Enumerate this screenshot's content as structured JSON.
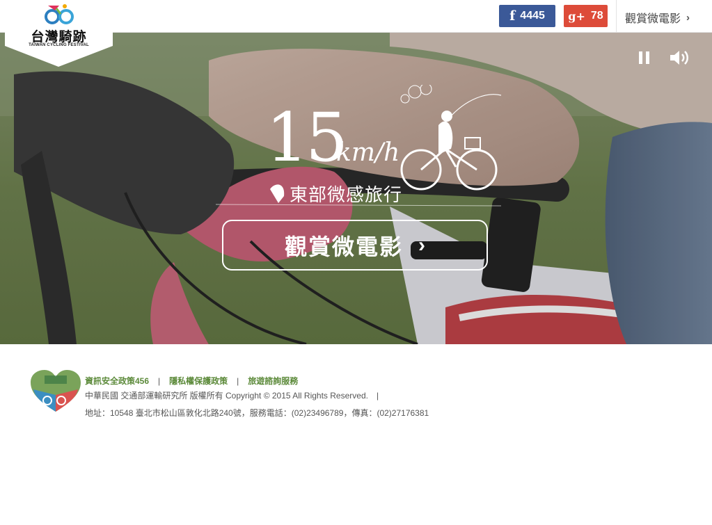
{
  "header": {
    "logo_text": "台灣騎跡",
    "logo_subtext": "TAIWAN CYCLING FESTIVAL",
    "facebook_count": "4445",
    "googleplus_count": "78",
    "watch_link_label": "觀賞微電影",
    "icons": {
      "facebook": "f",
      "googleplus": "g+",
      "chevron": "›"
    }
  },
  "hero": {
    "title_number": "15",
    "title_unit": "km/h",
    "subtitle": "東部微感旅行",
    "cta_label": "觀賞微電影",
    "controls": {
      "pause_icon": "pause-icon",
      "volume_icon": "volume-icon"
    }
  },
  "footer": {
    "links": [
      "資訊安全政策456",
      "隱私權保護政策",
      "旅遊諮詢服務"
    ],
    "separator": "|",
    "copyright": "中華民國 交通部運輸研究所 版權所有 Copyright © 2015 All Rights Reserved.　|",
    "address": "地址：10548 臺北市松山區敦化北路240號，服務電話：(02)23496789，傳真：(02)27176381"
  },
  "colors": {
    "facebook": "#3b5998",
    "googleplus": "#dd4b39",
    "footer_link": "#5c8a3a",
    "footer_text": "#555555"
  }
}
